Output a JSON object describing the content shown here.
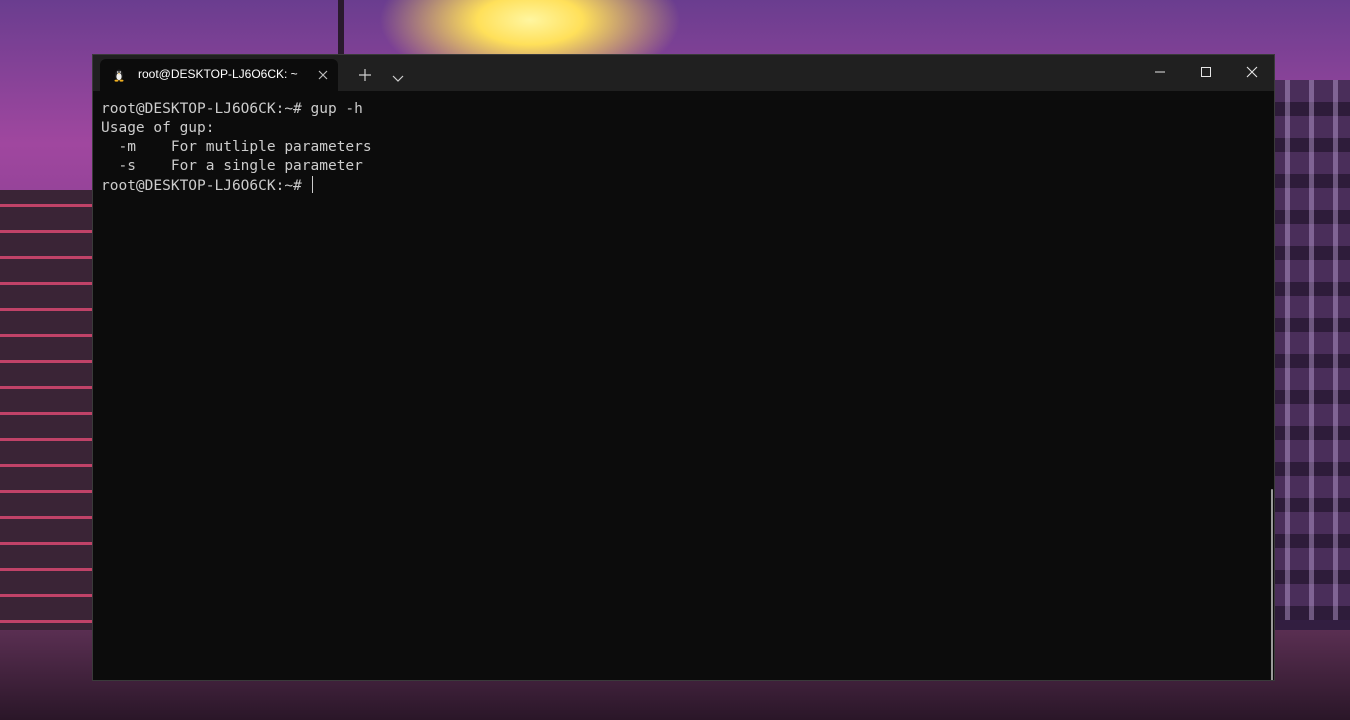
{
  "window": {
    "tab_title": "root@DESKTOP-LJ6O6CK: ~",
    "tab_icon": "linux-penguin-icon",
    "new_tab_icon": "plus-icon",
    "dropdown_icon": "chevron-down-icon",
    "minimize_icon": "minimize-icon",
    "maximize_icon": "maximize-icon",
    "close_icon": "close-icon"
  },
  "terminal": {
    "lines": [
      "root@DESKTOP-LJ6O6CK:~# gup -h",
      "Usage of gup:",
      "  -m    For mutliple parameters",
      "  -s    For a single parameter",
      "root@DESKTOP-LJ6O6CK:~# "
    ]
  },
  "colors": {
    "terminal_bg": "#0c0c0c",
    "terminal_fg": "#cccccc",
    "titlebar_bg": "#202020"
  }
}
